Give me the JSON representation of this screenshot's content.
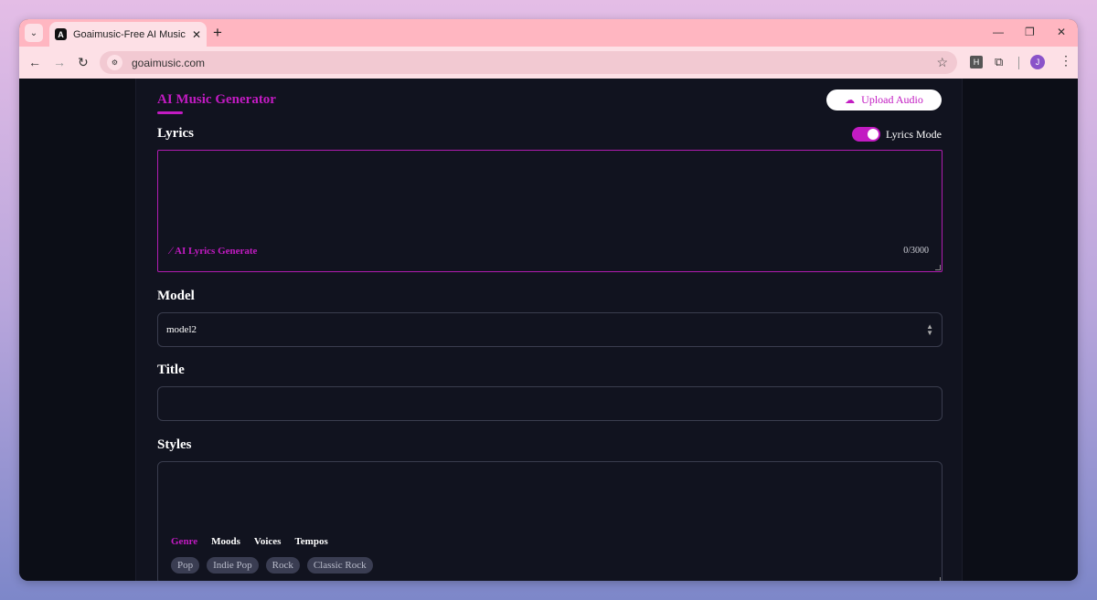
{
  "browser": {
    "tab_title": "Goaimusic-Free AI Music & Song Generator",
    "tab_favicon_letter": "A",
    "url": "goaimusic.com",
    "extension_label": "H",
    "profile_initial": "J"
  },
  "header": {
    "title": "AI Music Generator",
    "upload_label": "Upload Audio"
  },
  "lyrics": {
    "label": "Lyrics",
    "mode_label": "Lyrics Mode",
    "mode_on": true,
    "value": "",
    "ai_generate_label": "AI Lyrics Generate",
    "counter": "0/3000"
  },
  "model": {
    "label": "Model",
    "selected": "model2"
  },
  "title_field": {
    "label": "Title",
    "value": ""
  },
  "styles": {
    "label": "Styles",
    "tabs": [
      {
        "label": "Genre",
        "active": true
      },
      {
        "label": "Moods",
        "active": false
      },
      {
        "label": "Voices",
        "active": false
      },
      {
        "label": "Tempos",
        "active": false
      }
    ],
    "chips": [
      "Pop",
      "Indie Pop",
      "Rock",
      "Classic Rock"
    ]
  },
  "colors": {
    "accent": "#c21bc2",
    "page_bg": "#0c0e17",
    "panel_bg": "#11131f",
    "tab_strip": "#ffb6c1"
  }
}
